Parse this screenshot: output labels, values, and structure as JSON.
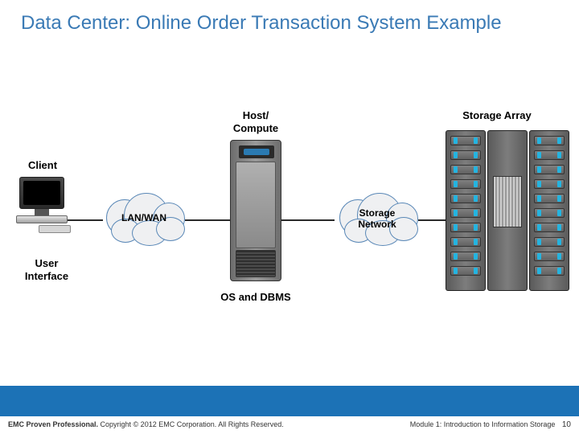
{
  "title": "Data Center: Online Order Transaction System Example",
  "labels": {
    "host_compute": "Host/\nCompute",
    "storage_array": "Storage Array",
    "client": "Client",
    "lan_wan": "LAN/WAN",
    "storage_network": "Storage\nNetwork",
    "user_interface": "User\nInterface",
    "os_dbms": "OS and DBMS"
  },
  "footer": {
    "left_bold": "EMC Proven Professional.",
    "left_rest": " Copyright © 2012 EMC Corporation. All Rights Reserved.",
    "right_module": "Module 1: Introduction to Information Storage",
    "page": "10"
  }
}
